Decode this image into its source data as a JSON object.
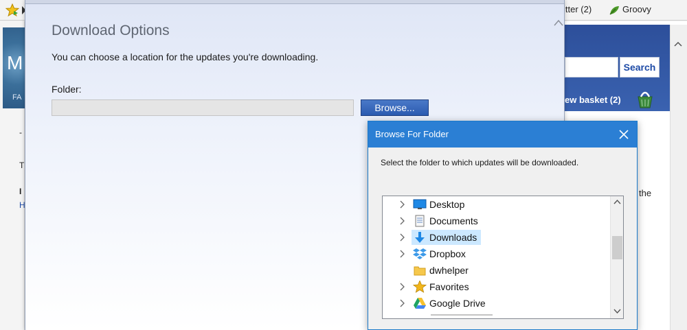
{
  "browser": {
    "toolbar": {
      "twitter_label": "itter (2)",
      "groovy_label": "Groovy"
    },
    "site": {
      "logo_letter": "M",
      "nav_fragment": "FA",
      "search_button": "Search",
      "basket_label": "ew basket (2)",
      "text_fragment_right": "the"
    }
  },
  "download_options": {
    "title": "Download Options",
    "description": "You can choose a location for the updates you're downloading.",
    "folder_label": "Folder:",
    "folder_value": "",
    "browse_button": "Browse..."
  },
  "browse_for_folder": {
    "title": "Browse For Folder",
    "instruction": "Select the folder to which updates will be downloaded.",
    "items": [
      {
        "label": "Desktop",
        "icon": "desktop-icon",
        "expandable": true,
        "selected": false
      },
      {
        "label": "Documents",
        "icon": "documents-icon",
        "expandable": true,
        "selected": false
      },
      {
        "label": "Downloads",
        "icon": "downloads-icon",
        "expandable": true,
        "selected": true
      },
      {
        "label": "Dropbox",
        "icon": "dropbox-icon",
        "expandable": true,
        "selected": false
      },
      {
        "label": "dwhelper",
        "icon": "folder-icon",
        "expandable": false,
        "selected": false
      },
      {
        "label": "Favorites",
        "icon": "favorites-star-icon",
        "expandable": true,
        "selected": false
      },
      {
        "label": "Google Drive",
        "icon": "google-drive-icon",
        "expandable": true,
        "selected": false
      }
    ]
  },
  "colors": {
    "titlebar_blue": "#2b7fd4",
    "selection_blue": "#cce8ff",
    "browse_button_blue": "#2b5bb0"
  }
}
